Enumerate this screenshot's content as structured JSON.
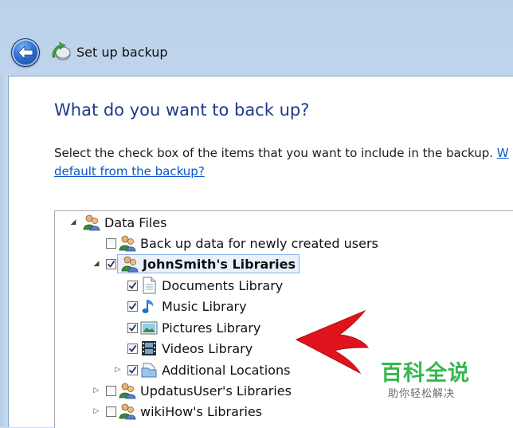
{
  "window": {
    "title": "Set up backup"
  },
  "page": {
    "heading": "What do you want to back up?",
    "description": "Select the check box of the items that you want to include in the backup.",
    "link_fragment": "W",
    "link_line2": "default from the backup?"
  },
  "tree": {
    "items": [
      {
        "label": "Data Files",
        "expander": "expanded",
        "checked": null,
        "icon": "users-icon"
      },
      {
        "label": "Back up data for newly created users",
        "expander": null,
        "checked": false,
        "icon": "users-icon"
      },
      {
        "label": "JohnSmith's Libraries",
        "expander": "expanded",
        "checked": true,
        "icon": "users-icon",
        "selected": true
      },
      {
        "label": "Documents Library",
        "expander": null,
        "checked": true,
        "icon": "document-icon"
      },
      {
        "label": "Music Library",
        "expander": null,
        "checked": true,
        "icon": "music-note-icon"
      },
      {
        "label": "Pictures Library",
        "expander": null,
        "checked": true,
        "icon": "picture-icon"
      },
      {
        "label": "Videos Library",
        "expander": null,
        "checked": true,
        "icon": "film-icon"
      },
      {
        "label": "Additional Locations",
        "expander": "collapsed",
        "checked": true,
        "icon": "folder-icon"
      },
      {
        "label": "UpdatusUser's Libraries",
        "expander": "collapsed",
        "checked": false,
        "icon": "users-icon"
      },
      {
        "label": "wikiHow's Libraries",
        "expander": "collapsed",
        "checked": false,
        "icon": "users-icon"
      }
    ]
  },
  "annotation": {
    "arrow_color": "#e0121b"
  },
  "watermark": {
    "title": "百科全说",
    "subtitle": "助你轻松解决",
    "color": "#35b84e"
  },
  "colors": {
    "heading": "#1e3a8c",
    "link": "#0b56c9",
    "selection": "#e9f1fb"
  }
}
